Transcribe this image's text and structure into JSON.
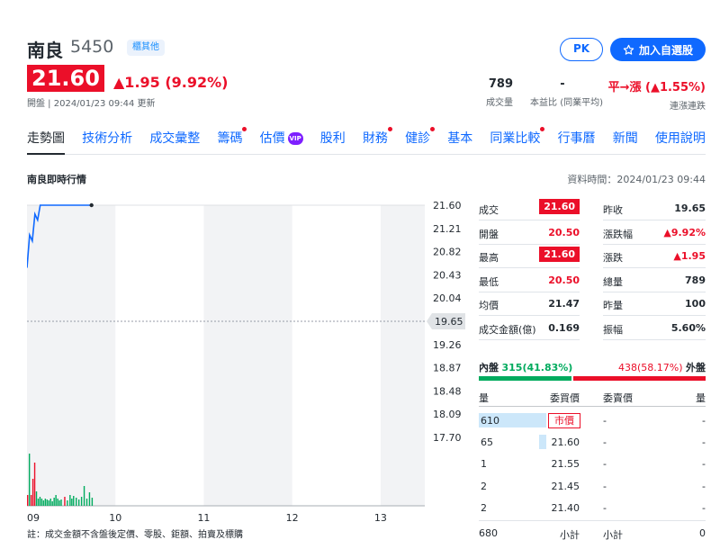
{
  "header": {
    "name": "南良",
    "code": "5450",
    "market_badge": "櫃其他",
    "pk_label": "PK",
    "watch_label": "加入自選股",
    "price": "21.60",
    "change": "▲1.95 (9.92%)",
    "status": "開盤 | 2024/01/23 09:44 更新",
    "stats": [
      {
        "value": "789",
        "label": "成交量"
      },
      {
        "value": "-",
        "label": "本益比 (同業平均)"
      },
      {
        "value": "平→漲 (▲1.55%)",
        "label": "連漲連跌"
      }
    ]
  },
  "tabs": [
    {
      "label": "走勢圖",
      "active": true,
      "dot": false
    },
    {
      "label": "技術分析",
      "dot": false
    },
    {
      "label": "成交彙整",
      "dot": false
    },
    {
      "label": "籌碼",
      "dot": true
    },
    {
      "label": "估價",
      "dot": false,
      "vip": "VIP"
    },
    {
      "label": "股利",
      "dot": false
    },
    {
      "label": "財務",
      "dot": true
    },
    {
      "label": "健診",
      "dot": true
    },
    {
      "label": "基本",
      "dot": false
    },
    {
      "label": "同業比較",
      "dot": true
    },
    {
      "label": "行事曆",
      "dot": false
    },
    {
      "label": "新聞",
      "dot": false
    },
    {
      "label": "使用說明",
      "dot": false
    }
  ],
  "section": {
    "title": "南良即時行情",
    "data_time": "資料時間：2024/01/23 09:44"
  },
  "chart_data": {
    "type": "line",
    "x_ticks": [
      "09",
      "10",
      "11",
      "12",
      "13"
    ],
    "y_ticks": [
      "21.60",
      "21.21",
      "20.82",
      "20.43",
      "20.04",
      "19.65",
      "19.26",
      "18.87",
      "18.48",
      "18.09",
      "17.70"
    ],
    "ylim": [
      17.7,
      21.6
    ],
    "reference": "19.65",
    "line": [
      [
        9.0,
        20.55
      ],
      [
        9.03,
        21.1
      ],
      [
        9.06,
        21.0
      ],
      [
        9.09,
        21.45
      ],
      [
        9.12,
        21.35
      ],
      [
        9.15,
        21.6
      ],
      [
        9.73,
        21.6
      ]
    ],
    "volume": [
      {
        "t": 9.0,
        "v": 12,
        "c": "red"
      },
      {
        "t": 9.02,
        "v": 58,
        "c": "green"
      },
      {
        "t": 9.04,
        "v": 12,
        "c": "red"
      },
      {
        "t": 9.06,
        "v": 30,
        "c": "red"
      },
      {
        "t": 9.08,
        "v": 48,
        "c": "red"
      },
      {
        "t": 9.1,
        "v": 16,
        "c": "green"
      },
      {
        "t": 9.12,
        "v": 8,
        "c": "green"
      },
      {
        "t": 9.14,
        "v": 10,
        "c": "green"
      },
      {
        "t": 9.16,
        "v": 8,
        "c": "green"
      },
      {
        "t": 9.18,
        "v": 6,
        "c": "green"
      },
      {
        "t": 9.2,
        "v": 8,
        "c": "green"
      },
      {
        "t": 9.22,
        "v": 7,
        "c": "green"
      },
      {
        "t": 9.24,
        "v": 6,
        "c": "green"
      },
      {
        "t": 9.26,
        "v": 8,
        "c": "green"
      },
      {
        "t": 9.28,
        "v": 5,
        "c": "green"
      },
      {
        "t": 9.3,
        "v": 9,
        "c": "green"
      },
      {
        "t": 9.32,
        "v": 12,
        "c": "green"
      },
      {
        "t": 9.34,
        "v": 8,
        "c": "green"
      },
      {
        "t": 9.36,
        "v": 6,
        "c": "green"
      },
      {
        "t": 9.38,
        "v": 7,
        "c": "green"
      },
      {
        "t": 9.42,
        "v": 10,
        "c": "red"
      },
      {
        "t": 9.45,
        "v": 6,
        "c": "green"
      },
      {
        "t": 9.48,
        "v": 12,
        "c": "green"
      },
      {
        "t": 9.5,
        "v": 8,
        "c": "green"
      },
      {
        "t": 9.52,
        "v": 11,
        "c": "green"
      },
      {
        "t": 9.55,
        "v": 9,
        "c": "green"
      },
      {
        "t": 9.58,
        "v": 7,
        "c": "green"
      },
      {
        "t": 9.61,
        "v": 10,
        "c": "green"
      },
      {
        "t": 9.64,
        "v": 22,
        "c": "green"
      },
      {
        "t": 9.67,
        "v": 8,
        "c": "green"
      },
      {
        "t": 9.7,
        "v": 15,
        "c": "green"
      },
      {
        "t": 9.73,
        "v": 9,
        "c": "green"
      }
    ]
  },
  "quote_left": [
    {
      "label": "成交",
      "value": "21.60",
      "boxed": true
    },
    {
      "label": "開盤",
      "value": "20.50",
      "color": "red"
    },
    {
      "label": "最高",
      "value": "21.60",
      "boxed": true
    },
    {
      "label": "最低",
      "value": "20.50",
      "color": "red"
    },
    {
      "label": "均價",
      "value": "21.47"
    },
    {
      "label": "成交金額(億)",
      "value": "0.169"
    }
  ],
  "quote_right": [
    {
      "label": "昨收",
      "value": "19.65"
    },
    {
      "label": "漲跌幅",
      "value": "▲9.92%",
      "color": "red"
    },
    {
      "label": "漲跌",
      "value": "▲1.95",
      "color": "red"
    },
    {
      "label": "總量",
      "value": "789"
    },
    {
      "label": "昨量",
      "value": "100"
    },
    {
      "label": "振幅",
      "value": "5.60%"
    }
  ],
  "inner_outer": {
    "inner_label": "內盤",
    "inner_value": "315(41.83%)",
    "inner_fraction": 0.4183,
    "outer_label": "外盤",
    "outer_value": "438(58.17%)"
  },
  "order_book": {
    "headers": [
      "量",
      "委買價",
      "委賣價",
      "量"
    ],
    "bids": [
      {
        "qty": "610",
        "price": "市價",
        "fraction": 1.0,
        "market": true
      },
      {
        "qty": "65",
        "price": "21.60",
        "fraction": 0.11
      },
      {
        "qty": "1",
        "price": "21.55",
        "fraction": 0.0
      },
      {
        "qty": "2",
        "price": "21.45",
        "fraction": 0.0
      },
      {
        "qty": "2",
        "price": "21.40",
        "fraction": 0.0
      }
    ],
    "asks": [
      {
        "price": "-",
        "qty": "-"
      },
      {
        "price": "-",
        "qty": "-"
      },
      {
        "price": "-",
        "qty": "-"
      },
      {
        "price": "-",
        "qty": "-"
      },
      {
        "price": "-",
        "qty": "-"
      }
    ],
    "subtotal_bid": "680",
    "subtotal_label": "小計",
    "subtotal_ask": "0"
  },
  "footnote": "註：成交金額不含盤後定價、零股、鉅額、拍賣及標購"
}
